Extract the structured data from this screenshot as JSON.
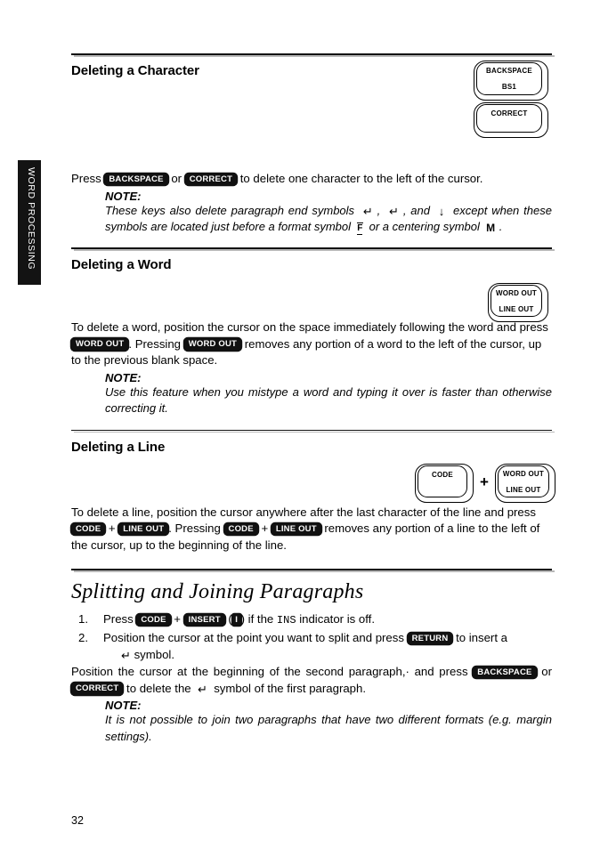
{
  "side_tab": {
    "label": "WORD PROCESSING"
  },
  "page_number": "32",
  "sections": {
    "deleting_character": {
      "heading": "Deleting a Character",
      "body_pre": "Press ",
      "key1": "BACKSPACE",
      "body_mid": " or ",
      "key2": "CORRECT",
      "body_post": " to delete one character to the left of the cursor.",
      "note_label": "NOTE:",
      "note_a": "These keys also delete paragraph end symbols",
      "note_sym1": "↵",
      "note_b": ",",
      "note_sym2": "↵",
      "note_c": ", and",
      "note_sym3": "↓",
      "note_d": "except when these symbols are located just before a format symbol",
      "note_sym4": "F",
      "note_e": "or a centering symbol",
      "note_sym5": "M",
      "note_f": "."
    },
    "deleting_word": {
      "heading": "Deleting a Word",
      "body_pre": "To delete a word, position the cursor on the space immediately following the word and press ",
      "key1": "WORD OUT",
      "body_mid": ". Pressing ",
      "key2": "WORD OUT",
      "body_post": " removes any portion of a word to the left of the cursor, up to the previous blank space.",
      "note_label": "NOTE:",
      "note_text": "Use this feature when you mistype a word and typing it over is faster than otherwise correcting it."
    },
    "deleting_line": {
      "heading": "Deleting a Line",
      "body_pre": "To delete a line, position the cursor anywhere after the last character of the line and press ",
      "key1": "CODE",
      "plus1": " + ",
      "key2": "LINE OUT",
      "body_mid": ". Pressing ",
      "key3": "CODE",
      "plus2": " + ",
      "key4": "LINE OUT",
      "body_post": " removes any portion of a line to the left of the cursor, up to the beginning of the line."
    },
    "splitting": {
      "heading": "Splitting and Joining Paragraphs",
      "step1": {
        "num": "1.",
        "pre": "Press ",
        "key1": "CODE",
        "plus": " + ",
        "key2": "INSERT",
        "mid": " (",
        "key3": "I",
        "post": ") if the ",
        "mono": "INS",
        "tail": " indicator is off."
      },
      "step2": {
        "num": "2.",
        "pre": "Position the cursor at the point you want to split and press ",
        "key1": "RETURN",
        "post": " to insert a",
        "sym": "↵",
        "tail": " symbol."
      },
      "para_pre": "Position the cursor at the beginning of the second paragraph,· and press ",
      "key1": "BACKSPACE",
      "para_mid": " or ",
      "key2": "CORRECT",
      "para_post": " to delete the",
      "para_sym": "↵",
      "para_tail": " symbol of the first paragraph.",
      "note_label": "NOTE:",
      "note_text": "It is not possible to join two paragraphs that have two different formats (e.g. margin settings)."
    }
  },
  "keycaps": {
    "backspace": {
      "top": "BACKSPACE",
      "bottom": "BS1"
    },
    "correct": {
      "top": "CORRECT"
    },
    "wordout_lineout": {
      "top": "WORD OUT",
      "bottom": "LINE OUT"
    },
    "code": {
      "top": "CODE"
    },
    "plus": "+"
  }
}
